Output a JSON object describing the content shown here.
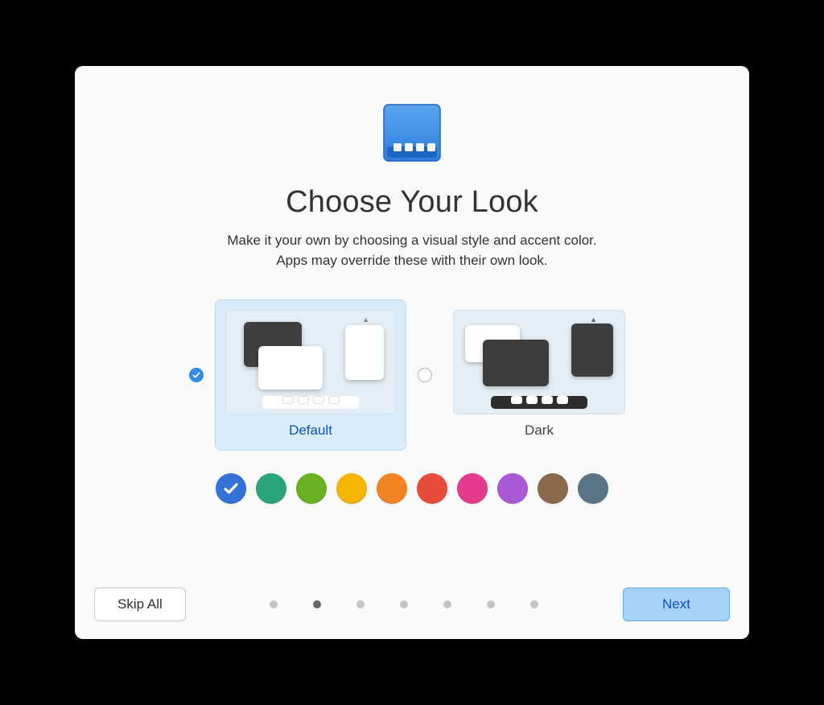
{
  "title": "Choose Your Look",
  "subtitle_line1": "Make it your own by choosing a visual style and accent color.",
  "subtitle_line2": "Apps may override these with their own look.",
  "themes": {
    "default_label": "Default",
    "dark_label": "Dark",
    "selected": "default"
  },
  "accent_colors": [
    {
      "name": "blue",
      "hex": "#3472d8",
      "selected": true
    },
    {
      "name": "teal",
      "hex": "#2aa57a",
      "selected": false
    },
    {
      "name": "green",
      "hex": "#6ab023",
      "selected": false
    },
    {
      "name": "yellow",
      "hex": "#f4b400",
      "selected": false
    },
    {
      "name": "orange",
      "hex": "#f28423",
      "selected": false
    },
    {
      "name": "red",
      "hex": "#e74c3c",
      "selected": false
    },
    {
      "name": "pink",
      "hex": "#e43b8d",
      "selected": false
    },
    {
      "name": "purple",
      "hex": "#a958d6",
      "selected": false
    },
    {
      "name": "brown",
      "hex": "#8a6a4a",
      "selected": false
    },
    {
      "name": "slate",
      "hex": "#5a7686",
      "selected": false
    }
  ],
  "pager": {
    "total": 7,
    "current": 1
  },
  "buttons": {
    "skip_label": "Skip All",
    "next_label": "Next"
  }
}
